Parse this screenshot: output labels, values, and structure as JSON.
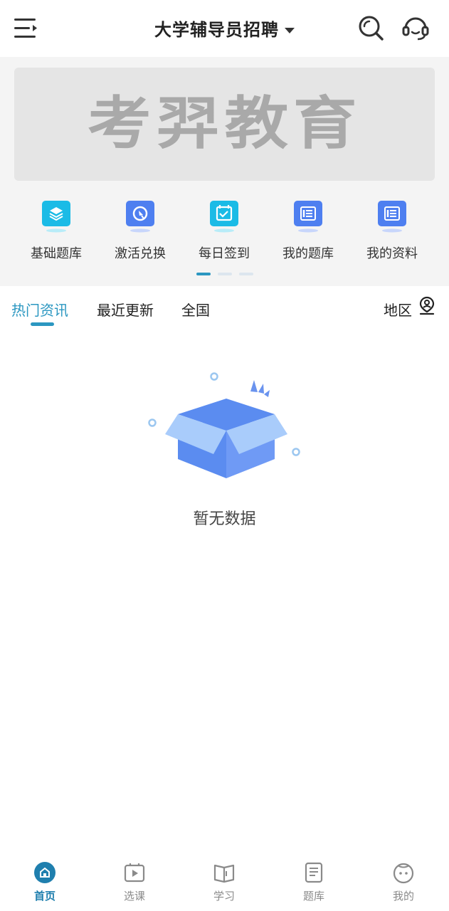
{
  "header": {
    "title": "大学辅导员招聘",
    "icons": [
      "menu-icon",
      "search-icon",
      "headset-icon"
    ]
  },
  "banner": {
    "logo_text": "考羿教育"
  },
  "quick_links": [
    {
      "label": "基础题库",
      "icon": "layers-icon",
      "color": "#1bbbe6"
    },
    {
      "label": "激活兑换",
      "icon": "refresh-icon",
      "color": "#4e7ff0"
    },
    {
      "label": "每日签到",
      "icon": "calendar-check-icon",
      "color": "#1bbbe6"
    },
    {
      "label": "我的题库",
      "icon": "list-icon",
      "color": "#4e7ff0"
    },
    {
      "label": "我的资料",
      "icon": "list-icon",
      "color": "#4e7ff0"
    }
  ],
  "carousel": {
    "page_count": 3,
    "active_index": 0
  },
  "tabs": {
    "items": [
      "热门资讯",
      "最近更新",
      "全国"
    ],
    "active_index": 0,
    "region_label": "地区"
  },
  "empty_state": {
    "message": "暂无数据"
  },
  "bottom_nav": {
    "items": [
      {
        "label": "首页",
        "icon": "home-icon"
      },
      {
        "label": "选课",
        "icon": "video-icon"
      },
      {
        "label": "学习",
        "icon": "book-icon"
      },
      {
        "label": "题库",
        "icon": "document-icon"
      },
      {
        "label": "我的",
        "icon": "face-icon"
      }
    ],
    "active_index": 0
  },
  "colors": {
    "accent": "#2b97c1",
    "nav_active": "#1f7fae",
    "banner_bg": "#e5e5e5",
    "hero_bg": "#f4f4f4"
  }
}
